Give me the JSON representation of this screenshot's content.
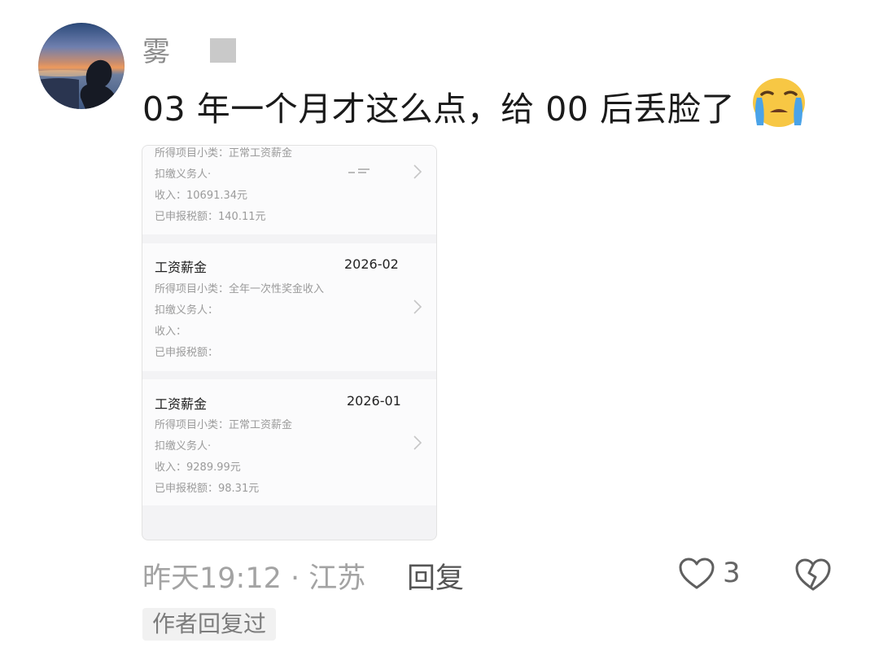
{
  "comment": {
    "username": "雾",
    "text": "03 年一个月才这么点，给 00 后丢脸了",
    "emoji": "loudly-crying-face",
    "time_location": "昨天19:12 · 江苏",
    "reply_label": "回复",
    "like_count": "3",
    "author_replied_label": "作者回复过"
  },
  "attachment": {
    "records": [
      {
        "title": "",
        "date": "",
        "category": "所得项目小类：正常工资薪金",
        "payer": "扣缴义务人·",
        "income": "收入：10691.34元",
        "tax": "已申报税额：140.11元"
      },
      {
        "title": "工资薪金",
        "date": "2026-02",
        "category": "所得项目小类：全年一次性奖金收入",
        "payer": "扣缴义务人：",
        "income": "收入：",
        "tax": "已申报税额："
      },
      {
        "title": "工资薪金",
        "date": "2026-01",
        "category": "所得项目小类：正常工资薪金",
        "payer": "扣缴义务人·",
        "income": "收入：9289.99元",
        "tax": "已申报税额：98.31元"
      }
    ]
  },
  "colors": {
    "background": "#ffffff",
    "text_primary": "#1a1a1a",
    "text_meta": "#a3a3a3",
    "card_background": "#fbfbfc"
  }
}
